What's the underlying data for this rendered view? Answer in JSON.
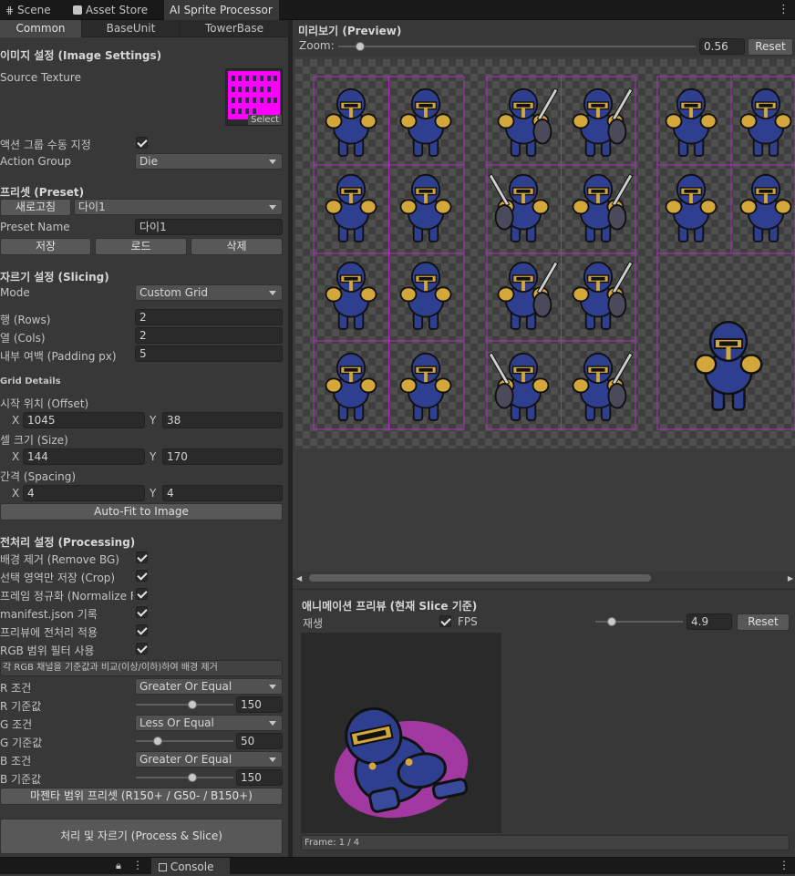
{
  "window_tabs": [
    {
      "label": "Scene",
      "icon": "grid-icon"
    },
    {
      "label": "Asset Store",
      "icon": "bag-icon"
    },
    {
      "label": "AI Sprite Processor",
      "icon": ""
    }
  ],
  "subtabs": [
    "Common",
    "BaseUnit",
    "TowerBase"
  ],
  "image_settings": {
    "header": "이미지 설정 (Image Settings)",
    "source_texture_label": "Source Texture",
    "select_label": "Select",
    "manual_group_label": "액션 그룹 수동 지정",
    "manual_group_checked": true,
    "action_group_label": "Action Group",
    "action_group_value": "Die"
  },
  "preset": {
    "header": "프리셋 (Preset)",
    "refresh_label": "새로고침",
    "preset_select_value": "다이1",
    "name_label": "Preset Name",
    "name_value": "다이1",
    "save_label": "저장",
    "load_label": "로드",
    "delete_label": "삭제"
  },
  "slicing": {
    "header": "자르기 설정 (Slicing)",
    "mode_label": "Mode",
    "mode_value": "Custom Grid",
    "rows_label": "행 (Rows)",
    "rows_value": "2",
    "cols_label": "열 (Cols)",
    "cols_value": "2",
    "padding_label": "내부 여백 (Padding px)",
    "padding_value": "5",
    "grid_details_label": "Grid Details",
    "offset_label": "시작 위치 (Offset)",
    "offset_x": "1045",
    "offset_y": "38",
    "size_label": "셀 크기 (Size)",
    "size_x": "144",
    "size_y": "170",
    "spacing_label": "간격 (Spacing)",
    "spacing_x": "4",
    "spacing_y": "4",
    "x_label": "X",
    "y_label": "Y",
    "autofit_label": "Auto-Fit to Image"
  },
  "processing": {
    "header": "전처리 설정 (Processing)",
    "toggles": [
      {
        "label": "배경 제거 (Remove BG)",
        "checked": true
      },
      {
        "label": "선택 영역만 저장 (Crop)",
        "checked": true
      },
      {
        "label": "프레임 정규화 (Normalize F",
        "checked": true
      },
      {
        "label": "manifest.json 기록",
        "checked": true
      },
      {
        "label": "프리뷰에 전처리 적용",
        "checked": true
      },
      {
        "label": "RGB 범위 필터 사용",
        "checked": true
      }
    ],
    "help_text": "각 RGB 채널을 기준값과 비교(이상/이하)하여 배경 제거",
    "r_cond_label": "R 조건",
    "r_cond_value": "Greater Or Equal",
    "r_thresh_label": "R 기준값",
    "r_thresh_value": "150",
    "g_cond_label": "G 조건",
    "g_cond_value": "Less Or Equal",
    "g_thresh_label": "G 기준값",
    "g_thresh_value": "50",
    "b_cond_label": "B 조건",
    "b_cond_value": "Greater Or Equal",
    "b_thresh_label": "B 기준값",
    "b_thresh_value": "150",
    "magenta_preset_label": "마젠타 범위 프리셋 (R150+ / G50- / B150+)",
    "process_label": "처리 및 자르기 (Process & Slice)"
  },
  "preview": {
    "header": "미리보기 (Preview)",
    "zoom_label": "Zoom:",
    "zoom_value": "0.56",
    "zoom_fraction": 0.06,
    "reset_label": "Reset"
  },
  "anim_preview": {
    "header": "애니메이션 프리뷰 (현재 Slice 기준)",
    "play_label": "재생",
    "play_checked": true,
    "fps_label": "FPS",
    "fps_value": "4.9",
    "fps_fraction": 0.19,
    "reset_label": "Reset",
    "frame_label": "Frame: 1 / 4"
  },
  "bottom": {
    "console_label": "Console"
  },
  "colors": {
    "accent_magenta": "#ff00ff",
    "grid_line": "#b02bc0",
    "knight_blue": "#2f3f8f",
    "knight_gold": "#d4a73a"
  }
}
